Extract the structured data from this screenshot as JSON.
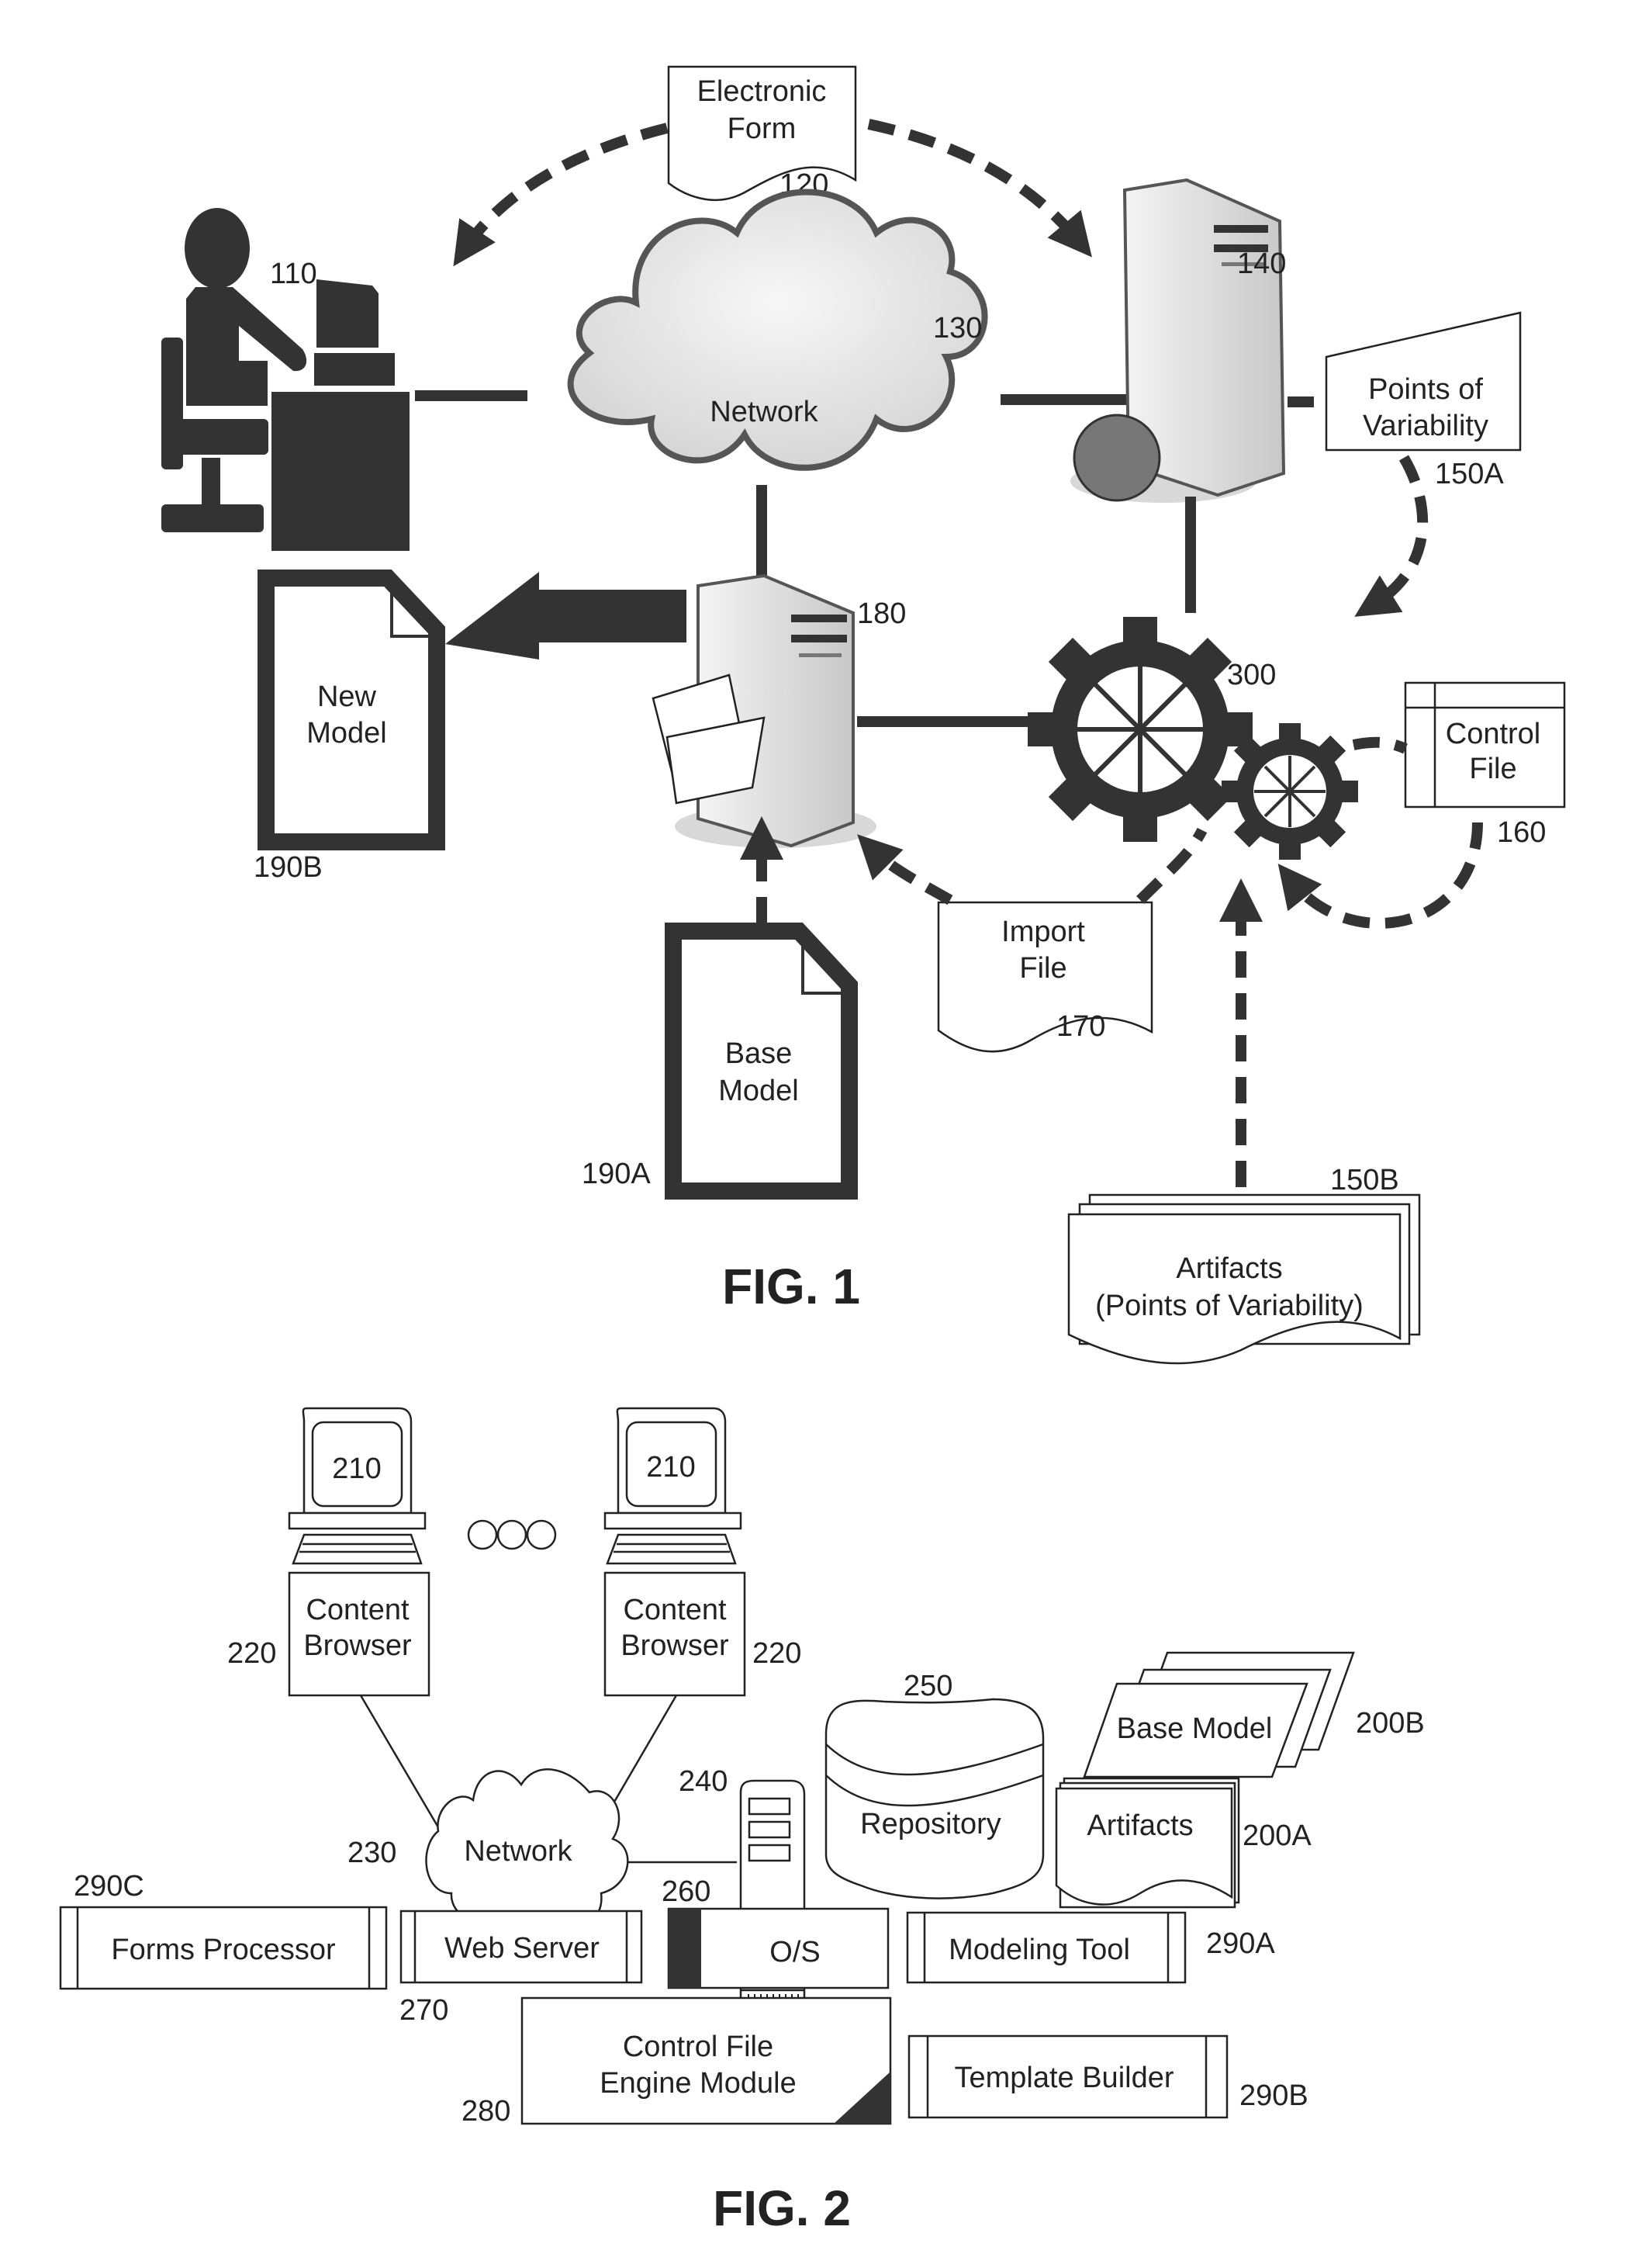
{
  "fig1": {
    "caption": "FIG. 1",
    "user": {
      "ref": "110"
    },
    "electronic_form": {
      "line1": "Electronic",
      "line2": "Form",
      "ref": "120"
    },
    "network": {
      "label": "Network",
      "ref": "130"
    },
    "web_server": {
      "ref": "140"
    },
    "points_of_variability": {
      "line1": "Points of",
      "line2": "Variability",
      "ref": "150A"
    },
    "engine": {
      "ref": "300"
    },
    "control_file": {
      "line1": "Control",
      "line2": "File",
      "ref": "160"
    },
    "model_server": {
      "ref": "180"
    },
    "new_model": {
      "line1": "New",
      "line2": "Model",
      "ref": "190B"
    },
    "base_model": {
      "line1": "Base",
      "line2": "Model",
      "ref": "190A"
    },
    "import_file": {
      "line1": "Import",
      "line2": "File",
      "ref": "170"
    },
    "artifacts": {
      "line1": "Artifacts",
      "line2": "(Points of Variability)",
      "ref": "150B"
    }
  },
  "fig2": {
    "caption": "FIG. 2",
    "clients": [
      {
        "screen_ref": "210",
        "browser_line1": "Content",
        "browser_line2": "Browser",
        "ref": "220"
      },
      {
        "screen_ref": "210",
        "browser_line1": "Content",
        "browser_line2": "Browser",
        "ref": "220"
      }
    ],
    "network": {
      "label": "Network",
      "ref": "230"
    },
    "server": {
      "ref": "240"
    },
    "repository": {
      "label": "Repository",
      "ref": "250"
    },
    "base_model": {
      "label": "Base Model",
      "ref": "200B"
    },
    "artifacts": {
      "label": "Artifacts",
      "ref": "200A"
    },
    "modules": {
      "forms_processor": {
        "label": "Forms Processor",
        "ref": "290C"
      },
      "web_server": {
        "label": "Web Server",
        "ref": "270"
      },
      "os": {
        "label": "O/S",
        "ref": "260"
      },
      "modeling_tool": {
        "label": "Modeling Tool",
        "ref": "290A"
      },
      "control_engine": {
        "line1": "Control File",
        "line2": "Engine Module",
        "ref": "280"
      },
      "template_builder": {
        "label": "Template Builder",
        "ref": "290B"
      }
    }
  }
}
